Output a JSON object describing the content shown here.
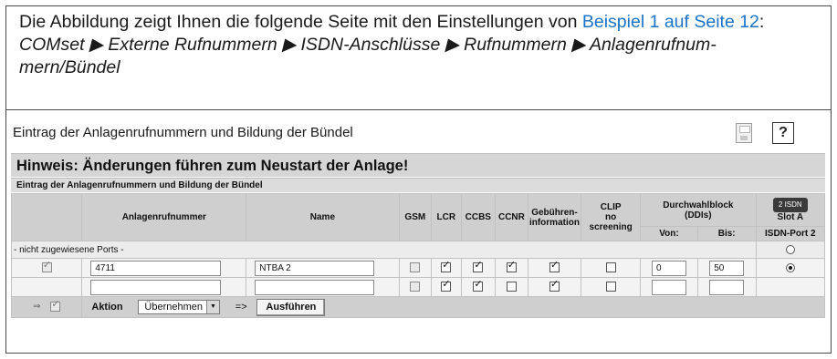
{
  "intro": {
    "text_before": "Die Abbildung zeigt Ihnen die folgende Seite mit den Einstellungen von ",
    "link": "Beispiel 1 auf Seite 12",
    "text_after": ":",
    "path_line1": "COMset ▶ Externe Rufnummern ▶ ISDN-Anschlüsse ▶ Rufnummern ▶ Anlagenrufnum-",
    "path_line2": "mern/Bündel",
    "link_color": "#1a73c8"
  },
  "page": {
    "title": "Eintrag der Anlagenrufnummern und Bildung der Bündel",
    "save_icon": "save-icon",
    "help_label": "?"
  },
  "hinweis": "Hinweis: Änderungen führen zum Neustart der Anlage!",
  "subheader": "Eintrag der Anlagenrufnummern und Bildung der Bündel",
  "columns": {
    "number": "Anlagenrufnummer",
    "name": "Name",
    "gsm": "GSM",
    "lcr": "LCR",
    "ccbs": "CCBS",
    "ccnr": "CCNR",
    "gebuehren_1": "Gebühren-",
    "gebuehren_2": "information",
    "clip_1": "CLIP",
    "clip_2": "no",
    "clip_3": "screening",
    "durchwahl_1": "Durchwahlblock",
    "durchwahl_2": "(DDIs)",
    "von": "Von:",
    "bis": "Bis:",
    "isdn_badge": "2 ISDN",
    "slot": "Slot A",
    "port": "ISDN-Port 2"
  },
  "not_assigned_label": "- nicht zugewiesene Ports -",
  "rows": [
    {
      "number": "4711",
      "name": "NTBA 2",
      "gsm": false,
      "lcr": true,
      "ccbs": true,
      "ccnr": true,
      "gebuehren": true,
      "clip": false,
      "von": "0",
      "bis": "50",
      "port_selected": true
    },
    {
      "number": "",
      "name": "",
      "gsm": false,
      "lcr": true,
      "ccbs": true,
      "ccnr": false,
      "gebuehren": true,
      "clip": false,
      "von": "",
      "bis": "",
      "port_selected": null
    }
  ],
  "action": {
    "label": "Aktion",
    "select_value": "Übernehmen",
    "arrow": "=>",
    "button": "Ausführen"
  }
}
